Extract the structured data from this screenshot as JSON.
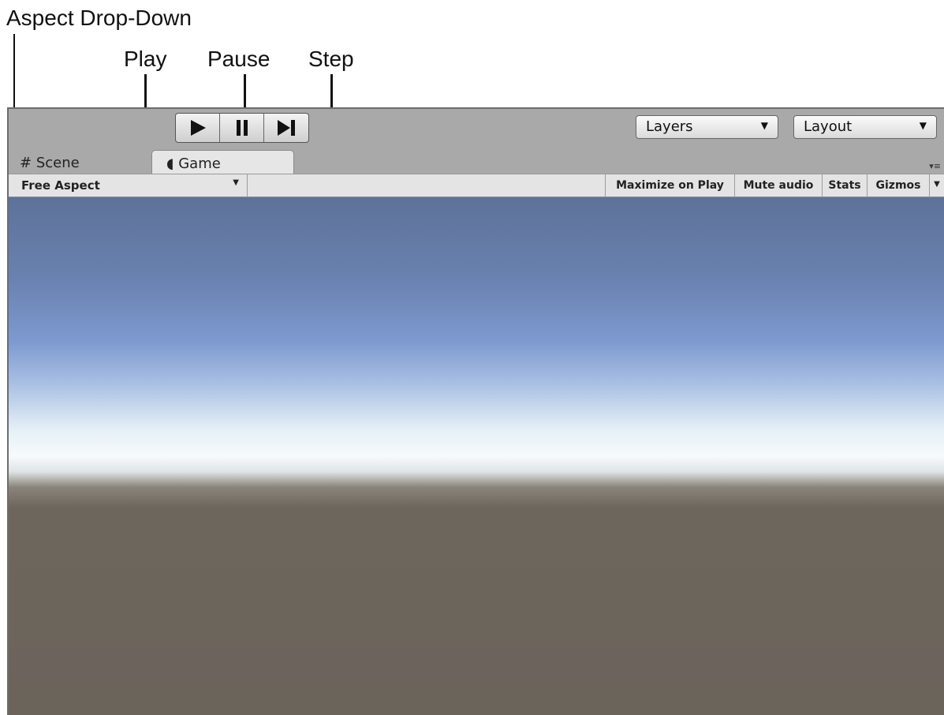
{
  "annotations": {
    "aspect": "Aspect Drop-Down",
    "play": "Play",
    "pause": "Pause",
    "step": "Step"
  },
  "toolbar": {
    "layers": "Layers",
    "layout": "Layout"
  },
  "tabs": {
    "scene": "Scene",
    "game": "Game"
  },
  "gamebar": {
    "aspect": "Free Aspect",
    "maximize": "Maximize on Play",
    "mute": "Mute audio",
    "stats": "Stats",
    "gizmos": "Gizmos"
  },
  "icons": {
    "play": "play-icon",
    "pause": "pause-icon",
    "step": "step-icon",
    "scene": "grid-icon",
    "game": "pacman-icon",
    "dropdown": "chevron-down-icon",
    "menu": "tab-menu-icon"
  }
}
